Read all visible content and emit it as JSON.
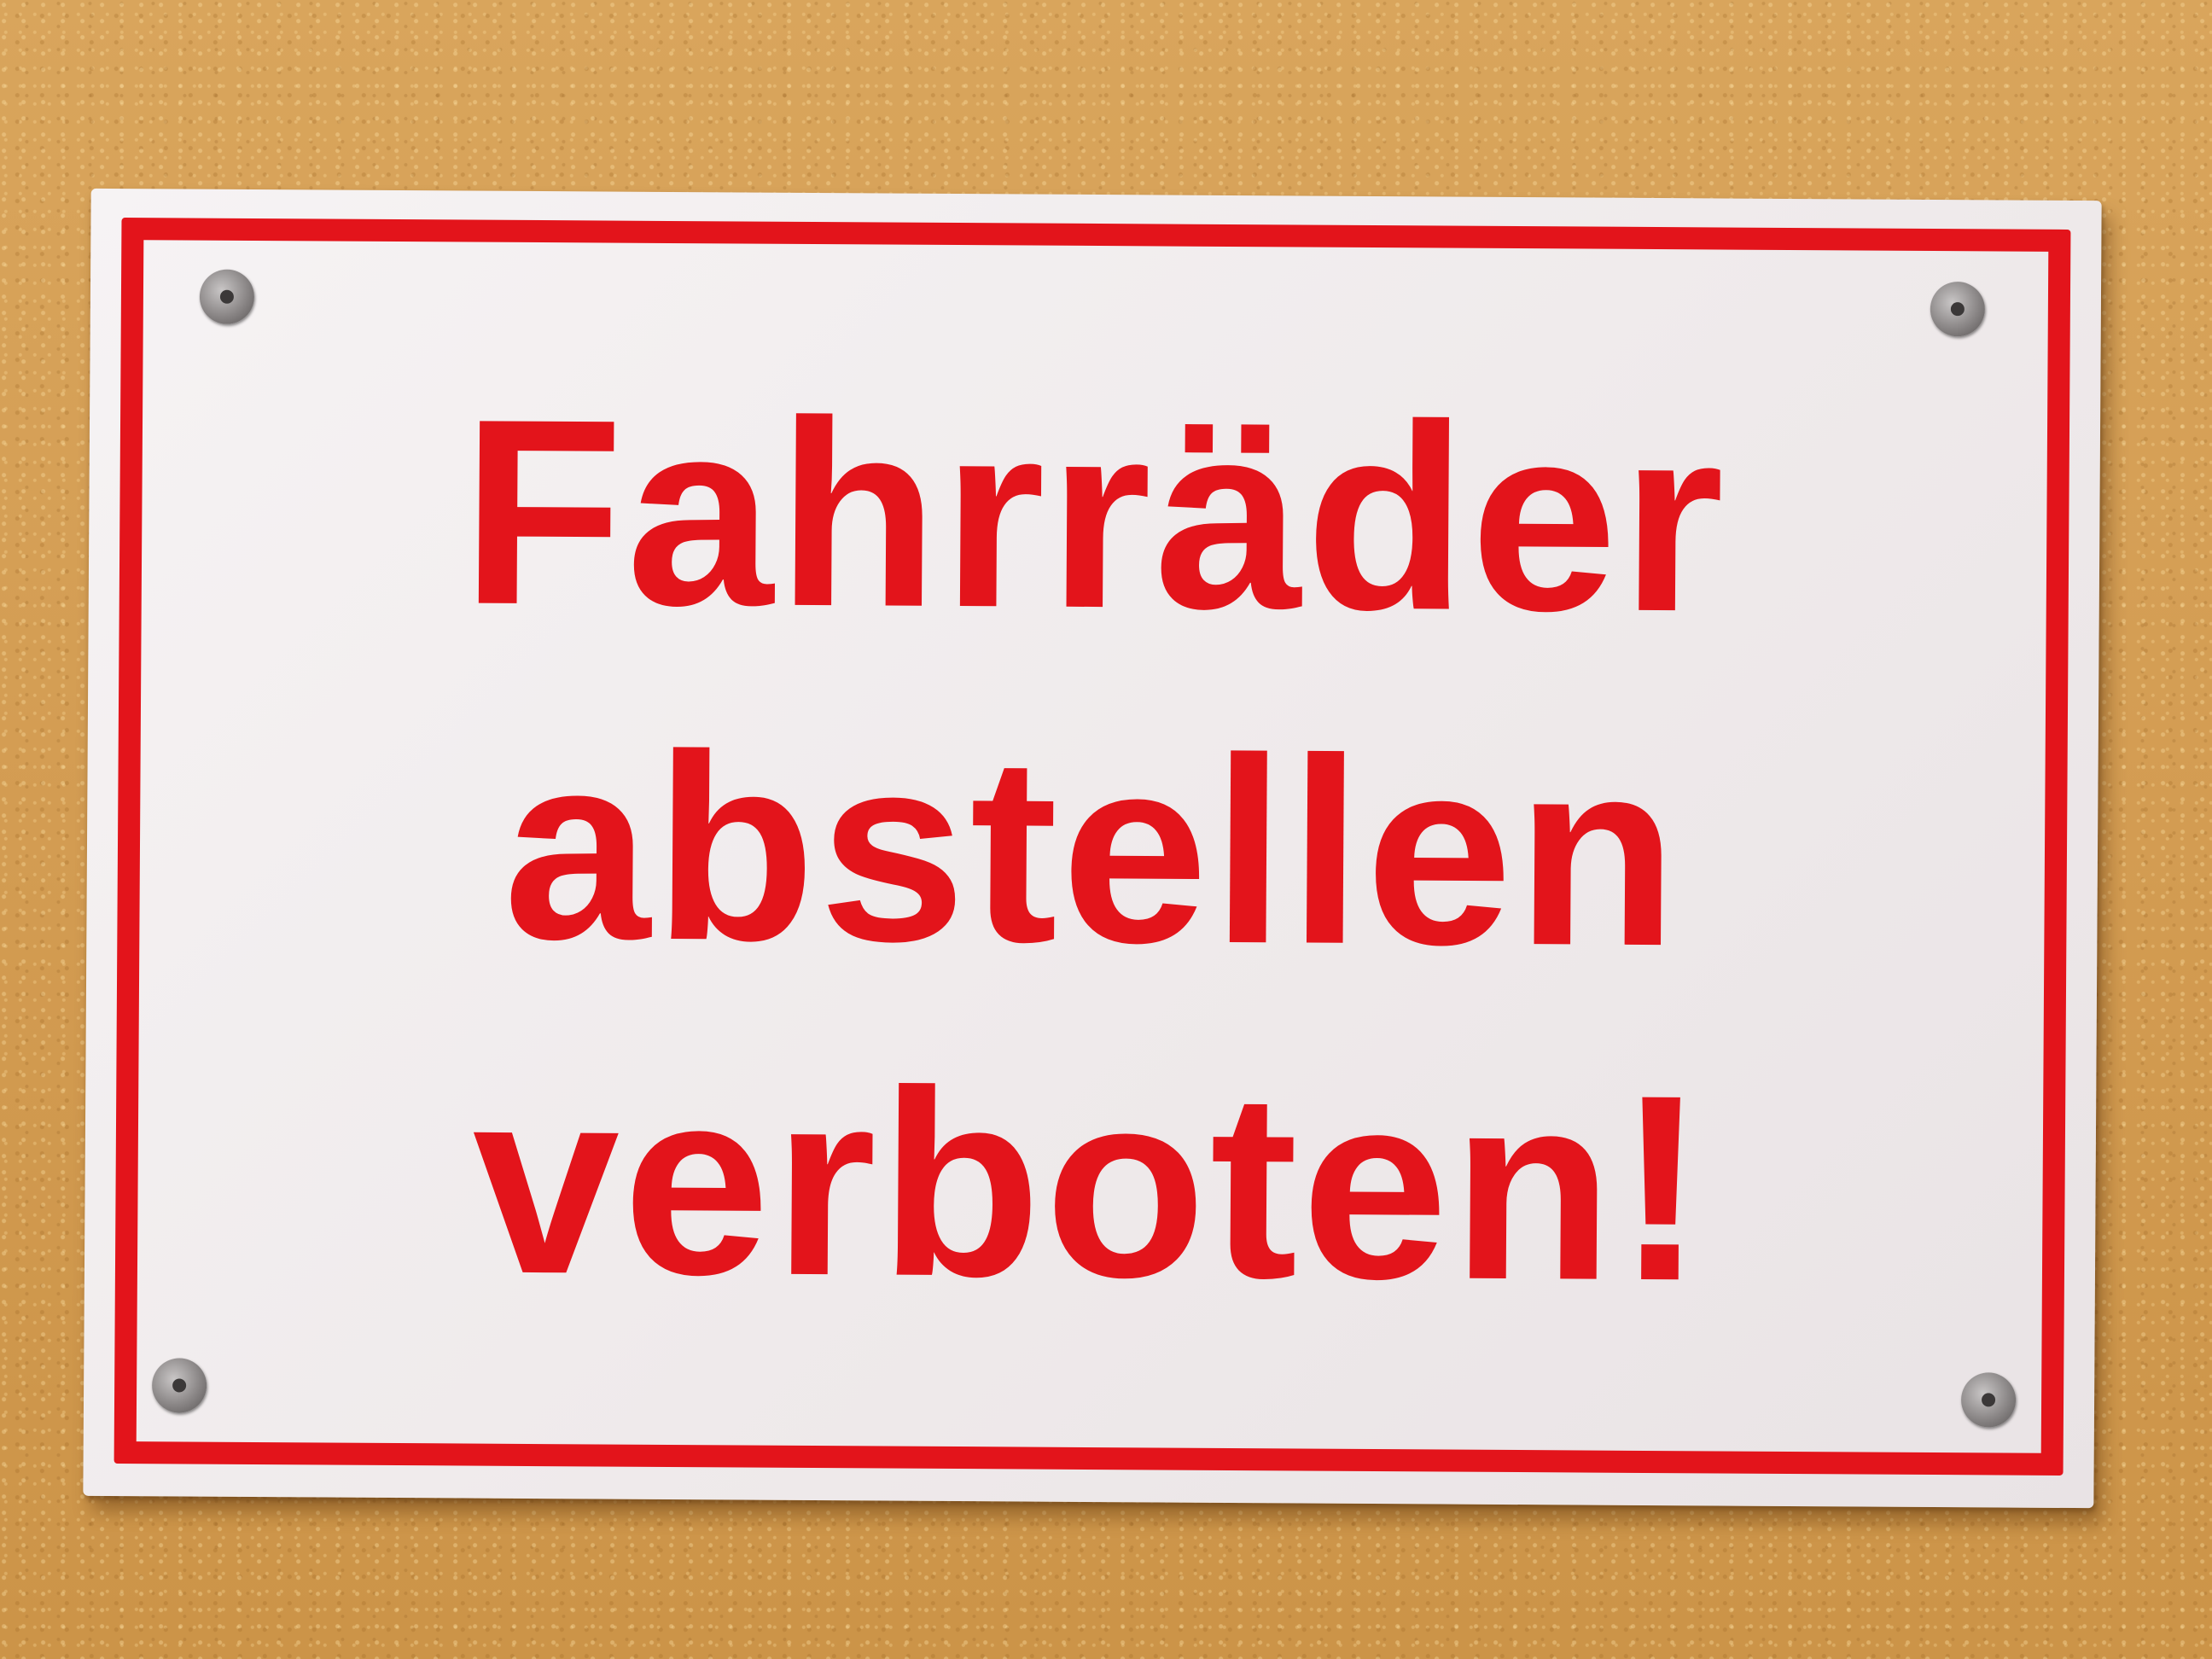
{
  "scene": {
    "wall_color": "#d39c52",
    "sign_background": "#f2eeef",
    "sign_accent": "#e3141b"
  },
  "sign": {
    "lines": [
      "Fahrräder",
      "abstellen",
      "verboten!"
    ],
    "screws": [
      "screw-icon",
      "screw-icon",
      "screw-icon",
      "screw-icon"
    ]
  }
}
